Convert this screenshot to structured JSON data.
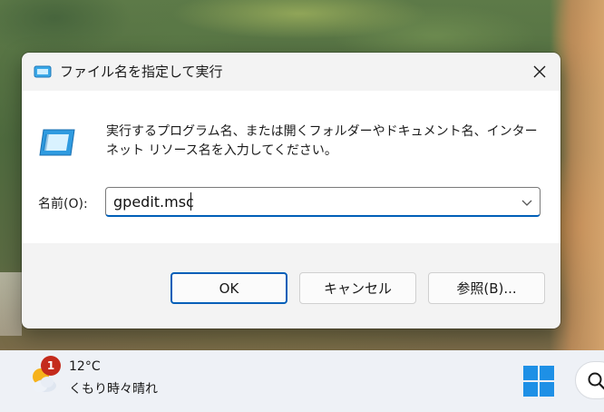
{
  "dialog": {
    "title": "ファイル名を指定して実行",
    "description_line1": "実行するプログラム名、または開くフォルダーやドキュメント名、インター",
    "description_line2": "ネット リソース名を入力してください。",
    "name_label": "名前(O):",
    "command_value": "gpedit.msc",
    "buttons": {
      "ok": "OK",
      "cancel": "キャンセル",
      "browse": "参照(B)..."
    },
    "icons": {
      "title": "run-icon",
      "body": "run-icon",
      "close": "close-icon",
      "dropdown": "chevron-down-icon"
    }
  },
  "taskbar": {
    "weather": {
      "badge": "1",
      "temperature": "12°C",
      "condition": "くもり時々晴れ",
      "icon": "partly-cloudy-icon"
    },
    "start_icon": "windows-start-icon",
    "search_icon": "search-icon"
  },
  "colors": {
    "accent": "#005fb8",
    "dialog_bg": "#f3f3f3",
    "taskbar_bg": "#eef1f6",
    "badge": "#c42b1c"
  }
}
